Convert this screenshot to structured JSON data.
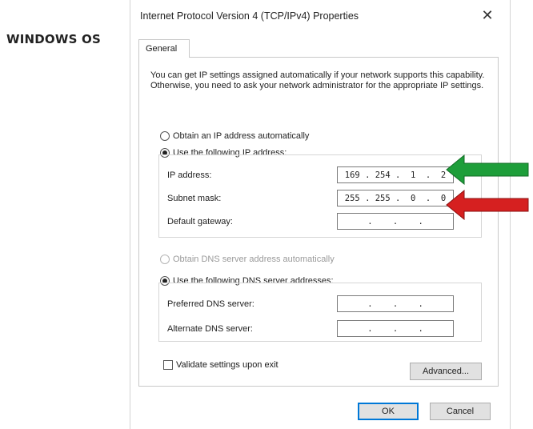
{
  "page_label": "WINDOWS OS",
  "dialog": {
    "title": "Internet Protocol Version 4 (TCP/IPv4) Properties",
    "close_glyph": "✕",
    "tab_general": "General",
    "description": "You can get IP settings assigned automatically if your network supports this capability. Otherwise, you need to ask your network administrator for the appropriate IP settings.",
    "ip_auto_label": "Obtain an IP address automatically",
    "ip_manual_label": "Use the following IP address:",
    "ip_address_label": "IP address:",
    "ip_address_value": "169 . 254 .  1  .  2",
    "subnet_label": "Subnet mask:",
    "subnet_value": "255 . 255 .  0  .  0",
    "gateway_label": "Default gateway:",
    "gateway_value": " .    .    . ",
    "dns_auto_label": "Obtain DNS server address automatically",
    "dns_manual_label": "Use the following DNS server addresses:",
    "preferred_dns_label": "Preferred DNS server:",
    "preferred_dns_value": " .    .    . ",
    "alternate_dns_label": "Alternate DNS server:",
    "alternate_dns_value": " .    .    . ",
    "validate_label": "Validate settings upon exit",
    "advanced_button": "Advanced...",
    "ok_button": "OK",
    "cancel_button": "Cancel"
  },
  "annotations": {
    "ip_arrow_color": "#1e9e3a",
    "subnet_arrow_color": "#d62020"
  },
  "state": {
    "ip_mode": "manual",
    "dns_mode": "manual",
    "validate_checked": false
  }
}
